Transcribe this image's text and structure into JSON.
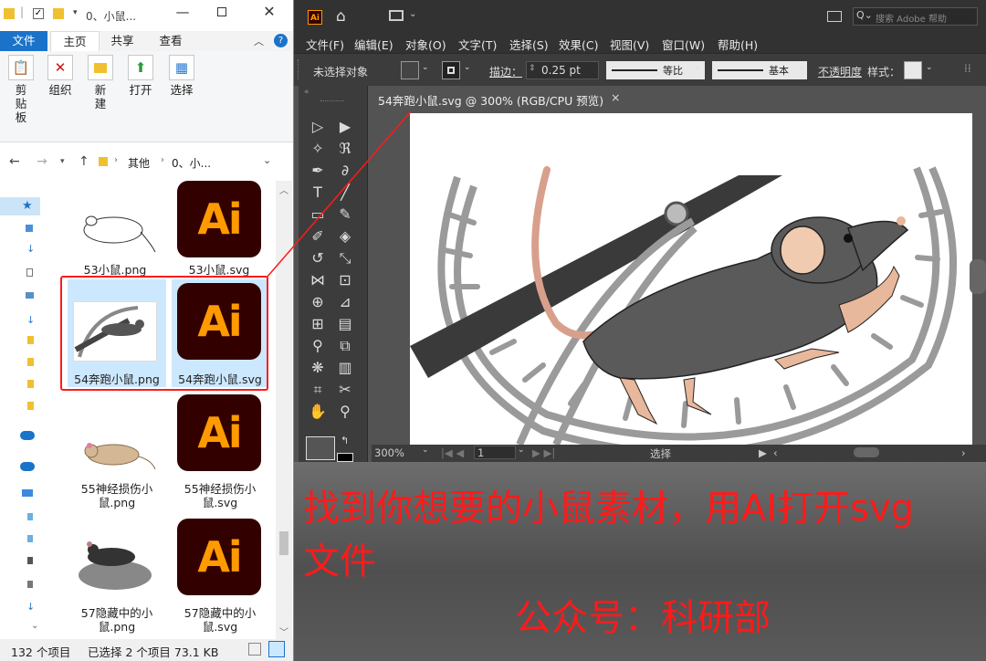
{
  "explorer": {
    "title": "0、小鼠...",
    "tabs": [
      "文件",
      "主页",
      "共享",
      "查看"
    ],
    "ribbon": [
      {
        "label": "剪贴板",
        "icon": "clipboard-icon"
      },
      {
        "label": "组织",
        "icon": "organize-icon"
      },
      {
        "label": "新建",
        "icon": "new-folder-icon"
      },
      {
        "label": "打开",
        "icon": "open-icon"
      },
      {
        "label": "选择",
        "icon": "select-icon"
      }
    ],
    "breadcrumb": [
      "其他",
      "0、小..."
    ],
    "files": [
      {
        "name": "53小鼠.png",
        "kind": "png"
      },
      {
        "name": "53小鼠.svg",
        "kind": "svg"
      },
      {
        "name": "54奔跑小鼠.png",
        "kind": "png"
      },
      {
        "name": "54奔跑小鼠.svg",
        "kind": "svg"
      },
      {
        "name": "55神经损伤小鼠.png",
        "kind": "png"
      },
      {
        "name": "55神经损伤小鼠.svg",
        "kind": "svg"
      },
      {
        "name": "57隐藏中的小鼠.png",
        "kind": "png"
      },
      {
        "name": "57隐藏中的小鼠.svg",
        "kind": "svg"
      }
    ],
    "ai_icon_text": "Ai",
    "status": {
      "count": "132 个项目",
      "selected": "已选择 2 个项目  73.1 KB"
    }
  },
  "illustrator": {
    "logo": "Ai",
    "search_placeholder": "搜索 Adobe 帮助",
    "menu": [
      "文件(F)",
      "编辑(E)",
      "对象(O)",
      "文字(T)",
      "选择(S)",
      "效果(C)",
      "视图(V)",
      "窗口(W)",
      "帮助(H)"
    ],
    "control": {
      "no_selection": "未选择对象",
      "stroke_label": "描边：",
      "stroke_value": "0.25 pt",
      "profile_uniform": "等比",
      "brush_basic": "基本",
      "opacity": "不透明度",
      "style": "样式："
    },
    "doc_tab": "54奔跑小鼠.svg @ 300% (RGB/CPU 预览)",
    "status": {
      "zoom": "300%",
      "artboard": "1",
      "tool": "选择"
    }
  },
  "caption": {
    "line1": "找到你想要的小鼠素材，用AI打开svg",
    "line2": "文件",
    "account": "公众号：科研部"
  },
  "colors": {
    "annotation_red": "#ff1a1a",
    "ai_dark": "#330000",
    "ai_orange": "#ff9a00"
  }
}
